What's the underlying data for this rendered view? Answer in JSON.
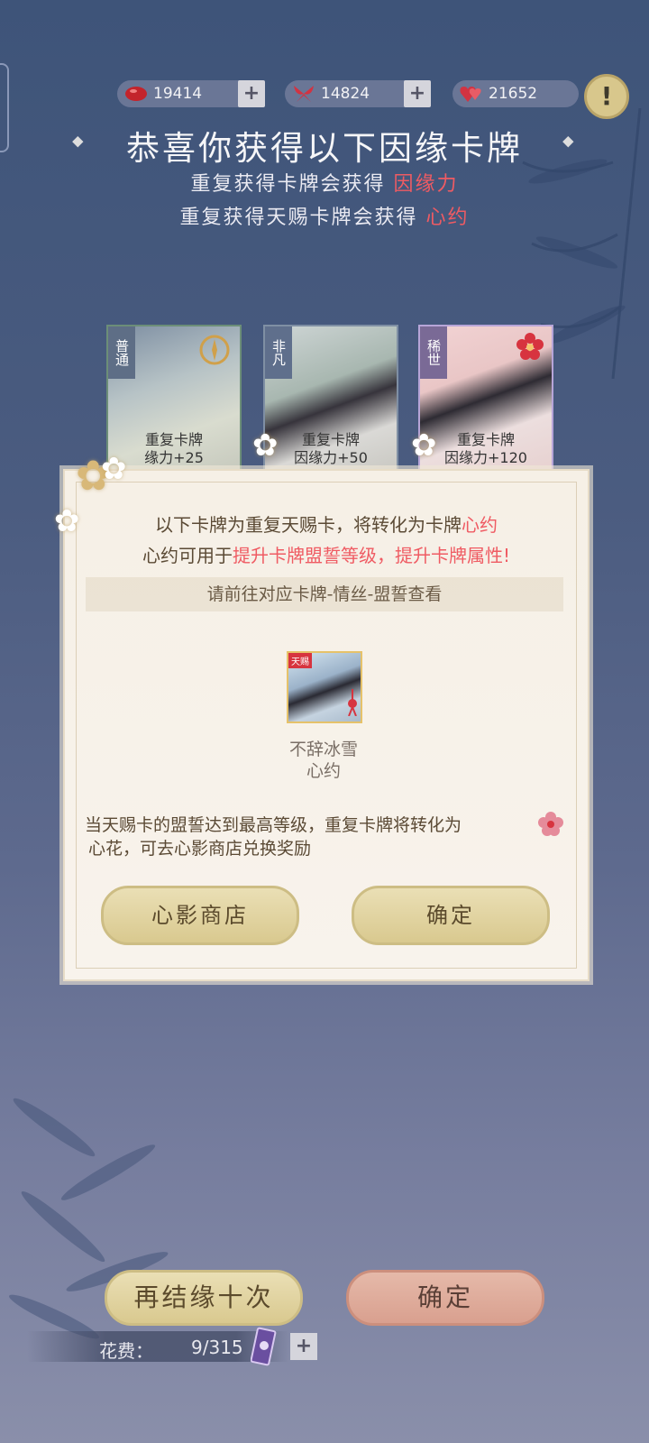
{
  "currency": [
    {
      "icon": "red-bean-icon",
      "value": "19414",
      "has_plus": true
    },
    {
      "icon": "red-butterfly-icon",
      "value": "14824",
      "has_plus": true
    },
    {
      "icon": "hearts-icon",
      "value": "21652",
      "has_plus": false
    }
  ],
  "header": {
    "title": "恭喜你获得以下因缘卡牌",
    "line1_prefix": "重复获得卡牌会获得",
    "line1_highlight": "因缘力",
    "line2_prefix": "重复获得天赐卡牌会获得",
    "line2_highlight": "心约"
  },
  "cards": [
    {
      "tag": "普通",
      "line1": "重复卡牌",
      "line2": "缘力+25"
    },
    {
      "tag": "非凡",
      "line1": "重复卡牌",
      "line2": "因缘力+50"
    },
    {
      "tag": "稀世",
      "line1": "重复卡牌",
      "line2": "因缘力+120"
    }
  ],
  "dialog": {
    "line1_prefix": "以下卡牌为重复天赐卡，将转化为卡牌",
    "line1_highlight": "心约",
    "line2_prefix": "心约可用于",
    "line2_highlight": "提升卡牌盟誓等级，提升卡牌属性!",
    "hint": "请前往对应卡牌-情丝-盟誓查看",
    "item_name": "不辞冰雪",
    "item_sub": "心约",
    "item_tag": "天赐",
    "note_line1": "当天赐卡的盟誓达到最高等级，重复卡牌将转化为",
    "note_line2": "心花，可去心影商店兑换奖励",
    "shop_button": "心影商店",
    "confirm_button": "确定"
  },
  "footer": {
    "again_button": "再结缘十次",
    "confirm_button": "确定",
    "cost_label": "花费：",
    "cost_value": "9/315"
  },
  "colors": {
    "highlight": "#ef5b63",
    "gold_button": "#d9c98f",
    "pink_button": "#d9a08f"
  }
}
